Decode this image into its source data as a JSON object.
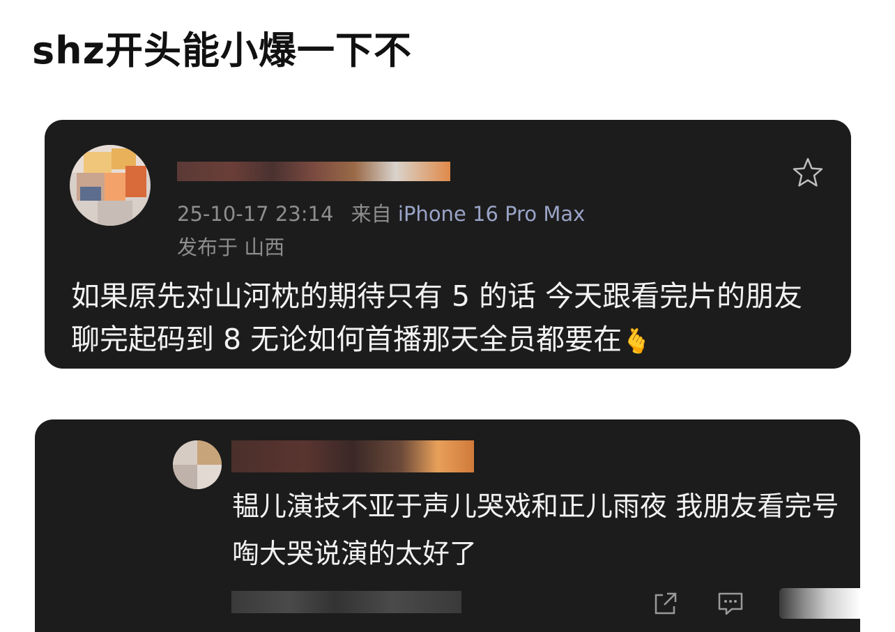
{
  "page": {
    "title": "shz开头能小爆一下不"
  },
  "post": {
    "timestamp": "25-10-17 23:14",
    "source_prefix": "来自",
    "device": "iPhone 16 Pro Max",
    "location": "发布于 山西",
    "content": "如果原先对山河枕的期待只有 5 的话 今天跟看完片的朋友聊完起码到 8 无论如何首播那天全员都要在",
    "emoji": "🫰",
    "favorite_icon": "star-outline-icon"
  },
  "reply": {
    "content": "韫儿演技不亚于声儿哭戏和正儿雨夜 我朋友看完号啕大哭说演的太好了",
    "actions": [
      "share-icon",
      "comment-icon",
      "like-icon"
    ]
  },
  "colors": {
    "card_background": "#1c1c1c",
    "meta_text": "#8e8e8e",
    "device_text": "#9aa4c8",
    "body_text": "#f2f2f2"
  }
}
